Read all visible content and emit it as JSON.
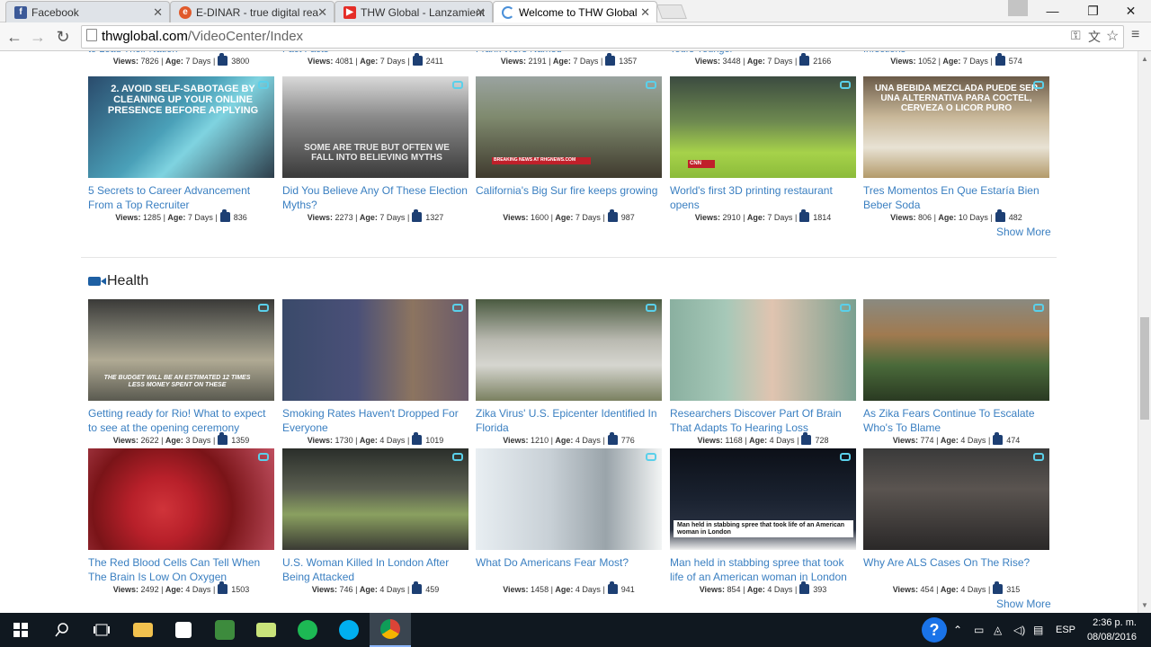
{
  "browser": {
    "tabs": [
      {
        "label": "Facebook",
        "favicon": "facebook-icon",
        "favicon_color": "#3b5998",
        "active": false
      },
      {
        "label": "E-DINAR - true digital rea",
        "favicon": "edinar-icon",
        "favicon_color": "#e05a2b",
        "active": false
      },
      {
        "label": "THW Global - Lanzamient",
        "favicon": "youtube-icon",
        "favicon_color": "#e52d27",
        "active": false
      },
      {
        "label": "Welcome to THW Global",
        "favicon": "loading-icon",
        "favicon_color": "#4a90d9",
        "active": true
      }
    ],
    "url_host": "thwglobal.com",
    "url_path": "/VideoCenter/Index"
  },
  "partial_row": [
    {
      "title": "to Lead Their Nation",
      "views": "7826",
      "age": "7 Days",
      "likes": "3800"
    },
    {
      "title": "Fact Facts",
      "views": "4081",
      "age": "7 Days",
      "likes": "2411"
    },
    {
      "title": "Frank Were Named",
      "views": "2191",
      "age": "7 Days",
      "likes": "1357"
    },
    {
      "title": "Tours Younger",
      "views": "3448",
      "age": "7 Days",
      "likes": "2166"
    },
    {
      "title": "Infections",
      "views": "1052",
      "age": "7 Days",
      "likes": "574"
    }
  ],
  "labels": {
    "views": "Views:",
    "age": "Age:",
    "separator": "|",
    "show_more": "Show More"
  },
  "row_a": [
    {
      "title": "5 Secrets to Career Advancement From a Top Recruiter",
      "views": "1285",
      "age": "7 Days",
      "likes": "836",
      "overlay": "2. AVOID SELF-SABOTAGE BY CLEANING UP YOUR ONLINE PRESENCE BEFORE APPLYING"
    },
    {
      "title": "Did You Believe Any Of These Election Myths?",
      "views": "2273",
      "age": "7 Days",
      "likes": "1327",
      "overlay": "SOME ARE TRUE BUT OFTEN WE FALL INTO BELIEVING MYTHS"
    },
    {
      "title": "California's Big Sur fire keeps growing",
      "views": "1600",
      "age": "7 Days",
      "likes": "987",
      "overlay": "BREAKING NEWS AT RHGNEWS.COM"
    },
    {
      "title": "World's first 3D printing restaurant opens",
      "views": "2910",
      "age": "7 Days",
      "likes": "1814",
      "overlay": "CNN"
    },
    {
      "title": "Tres Momentos En Que Estaría Bien Beber Soda",
      "views": "806",
      "age": "10 Days",
      "likes": "482",
      "overlay": "UNA BEBIDA MEZCLADA PUEDE SER UNA ALTERNATIVA PARA COCTEL, CERVEZA O LICOR PURO"
    }
  ],
  "health": {
    "heading": "Health",
    "row_b": [
      {
        "title": "Getting ready for Rio! What to expect to see at the opening ceremony",
        "views": "2622",
        "age": "3 Days",
        "likes": "1359",
        "overlay": "THE BUDGET WILL BE AN ESTIMATED 12 TIMES LESS MONEY SPENT ON THESE"
      },
      {
        "title": "Smoking Rates Haven't Dropped For Everyone",
        "views": "1730",
        "age": "4 Days",
        "likes": "1019",
        "overlay": ""
      },
      {
        "title": "Zika Virus' U.S. Epicenter Identified In Florida",
        "views": "1210",
        "age": "4 Days",
        "likes": "776",
        "overlay": ""
      },
      {
        "title": "Researchers Discover Part Of Brain That Adapts To Hearing Loss",
        "views": "1168",
        "age": "4 Days",
        "likes": "728",
        "overlay": ""
      },
      {
        "title": "As Zika Fears Continue To Escalate Who's To Blame",
        "views": "774",
        "age": "4 Days",
        "likes": "474",
        "overlay": ""
      }
    ],
    "row_c": [
      {
        "title": "The Red Blood Cells Can Tell When The Brain Is Low On Oxygen",
        "views": "2492",
        "age": "4 Days",
        "likes": "1503",
        "overlay": ""
      },
      {
        "title": "U.S. Woman Killed In London After Being Attacked",
        "views": "746",
        "age": "4 Days",
        "likes": "459",
        "overlay": ""
      },
      {
        "title": "What Do Americans Fear Most?",
        "views": "1458",
        "age": "4 Days",
        "likes": "941",
        "overlay": ""
      },
      {
        "title": "Man held in stabbing spree that took life of an American woman in London",
        "views": "854",
        "age": "4 Days",
        "likes": "393",
        "overlay": "Man held in stabbing spree that took life of an American woman in London"
      },
      {
        "title": "Why Are ALS Cases On The Rise?",
        "views": "454",
        "age": "4 Days",
        "likes": "315",
        "overlay": ""
      }
    ]
  },
  "taskbar": {
    "language": "ESP",
    "time": "2:36 p. m.",
    "date": "08/08/2016",
    "help": "?"
  }
}
